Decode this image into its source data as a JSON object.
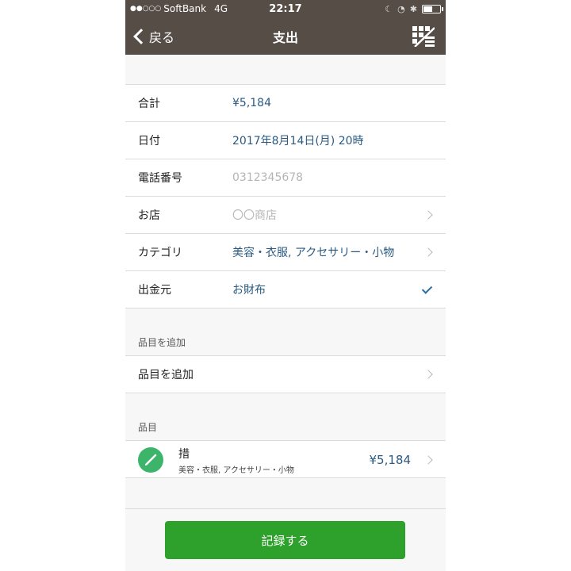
{
  "status_bar": {
    "signal": "●●○○○",
    "carrier": "SoftBank",
    "network": "4G",
    "time": "22:17"
  },
  "nav": {
    "back_label": "戻る",
    "title": "支出"
  },
  "form_rows": [
    {
      "label": "合計",
      "value": "¥5,184"
    },
    {
      "label": "日付",
      "value": "2017年8月14日(月) 20時"
    },
    {
      "label": "電話番号",
      "placeholder": "0312345678"
    },
    {
      "label": "お店",
      "placeholder": "〇〇商店"
    },
    {
      "label": "カテゴリ",
      "value": "美容・衣服, アクセサリー・小物"
    },
    {
      "label": "出金元",
      "value": "お財布"
    }
  ],
  "add_item_section": {
    "header": "品目を追加",
    "row_label": "品目を追加"
  },
  "items_section": {
    "header": "品目",
    "items": [
      {
        "name": "措",
        "category": "美容・衣服, アクセサリー・小物",
        "price": "¥5,184",
        "icon": "brush-icon"
      }
    ]
  },
  "record_button": "記録する",
  "colors": {
    "nav_bg": "#574d47",
    "value_text": "#2a5a82",
    "accent_green": "#2ea12c",
    "icon_green": "#3cb56a"
  }
}
